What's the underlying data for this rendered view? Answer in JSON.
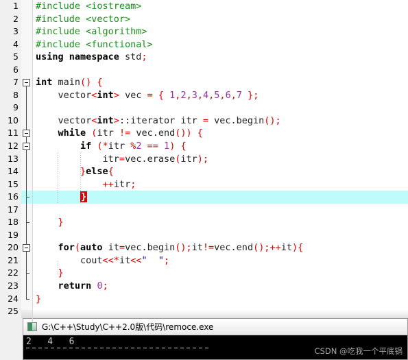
{
  "editor": {
    "language": "cpp",
    "highlighted_line": 16,
    "lines": [
      {
        "n": "1",
        "text": "#include <iostream>"
      },
      {
        "n": "2",
        "text": "#include <vector>"
      },
      {
        "n": "3",
        "text": "#include <algorithm>"
      },
      {
        "n": "4",
        "text": "#include <functional>"
      },
      {
        "n": "5",
        "text": "using namespace std;"
      },
      {
        "n": "6",
        "text": ""
      },
      {
        "n": "7",
        "text": "int main() {"
      },
      {
        "n": "8",
        "text": "    vector<int> vec = { 1,2,3,4,5,6,7 };"
      },
      {
        "n": "9",
        "text": ""
      },
      {
        "n": "10",
        "text": "    vector<int>::iterator itr = vec.begin();"
      },
      {
        "n": "11",
        "text": "    while (itr != vec.end()) {"
      },
      {
        "n": "12",
        "text": "        if (*itr %2 == 1) {"
      },
      {
        "n": "13",
        "text": "            itr=vec.erase(itr);"
      },
      {
        "n": "14",
        "text": "        }else{"
      },
      {
        "n": "15",
        "text": "            ++itr;"
      },
      {
        "n": "16",
        "text": "        }"
      },
      {
        "n": "17",
        "text": ""
      },
      {
        "n": "18",
        "text": "    }"
      },
      {
        "n": "19",
        "text": ""
      },
      {
        "n": "20",
        "text": "    for(auto it=vec.begin();it!=vec.end();++it){"
      },
      {
        "n": "21",
        "text": "        cout<<*it<<\"  \";"
      },
      {
        "n": "22",
        "text": "    }"
      },
      {
        "n": "23",
        "text": "    return 0;"
      },
      {
        "n": "24",
        "text": "}"
      },
      {
        "n": "25",
        "text": ""
      }
    ],
    "fold_boxes": [
      7,
      11,
      12,
      20
    ],
    "fold_ticks": [
      16,
      18,
      22
    ],
    "colors": {
      "preprocessor": "#1a8f1a",
      "keyword": "#000000",
      "number": "#9b2fa6",
      "string": "#0000e0",
      "operator": "#e00000",
      "plain": "#222222",
      "line_highlight": "#bffbfb",
      "bracket_match_bg": "#e00000",
      "gutter_bg": "#f0f0f0"
    }
  },
  "console": {
    "title": "G:\\C++\\Study\\C++2.0版\\代码\\remoce.exe",
    "output": "2   4   6"
  },
  "watermark": {
    "text": "CSDN @吃我一个平底锅"
  }
}
